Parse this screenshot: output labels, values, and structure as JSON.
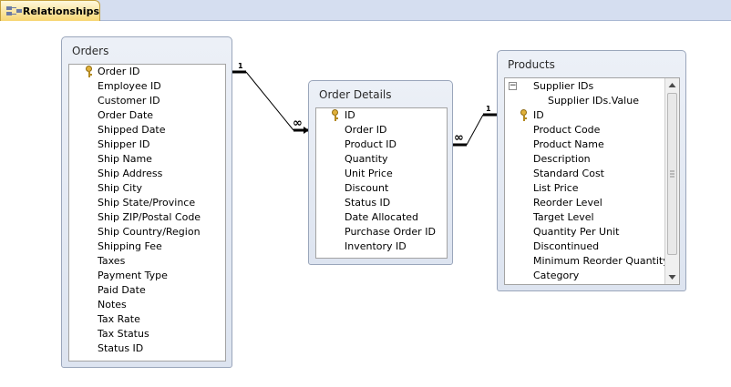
{
  "tab": {
    "label": "Relationships",
    "icon": "relationships-icon"
  },
  "tables": {
    "orders": {
      "title": "Orders",
      "fields": [
        "Order ID",
        "Employee ID",
        "Customer ID",
        "Order Date",
        "Shipped Date",
        "Shipper ID",
        "Ship Name",
        "Ship Address",
        "Ship City",
        "Ship State/Province",
        "Ship ZIP/Postal Code",
        "Ship Country/Region",
        "Shipping Fee",
        "Taxes",
        "Payment Type",
        "Paid Date",
        "Notes",
        "Tax Rate",
        "Tax Status",
        "Status ID"
      ]
    },
    "order_details": {
      "title": "Order Details",
      "fields": [
        "ID",
        "Order ID",
        "Product ID",
        "Quantity",
        "Unit Price",
        "Discount",
        "Status ID",
        "Date Allocated",
        "Purchase Order ID",
        "Inventory ID"
      ]
    },
    "products": {
      "title": "Products",
      "fields": [
        "Supplier IDs",
        "Supplier IDs.Value",
        "ID",
        "Product Code",
        "Product Name",
        "Description",
        "Standard Cost",
        "List Price",
        "Reorder Level",
        "Target Level",
        "Quantity Per Unit",
        "Discontinued",
        "Minimum Reorder Quantity",
        "Category"
      ]
    }
  },
  "relationships": [
    {
      "from": "Orders.Order ID",
      "to": "Order Details.Order ID",
      "one_label": "1",
      "many_label": "∞"
    },
    {
      "from": "Products.ID",
      "to": "Order Details.Product ID",
      "one_label": "1",
      "many_label": "∞"
    }
  ],
  "colors": {
    "tab_bg": "#f7d673",
    "tabbar_bg": "#d5def0",
    "key": "#e1b13a",
    "line": "#000000"
  }
}
